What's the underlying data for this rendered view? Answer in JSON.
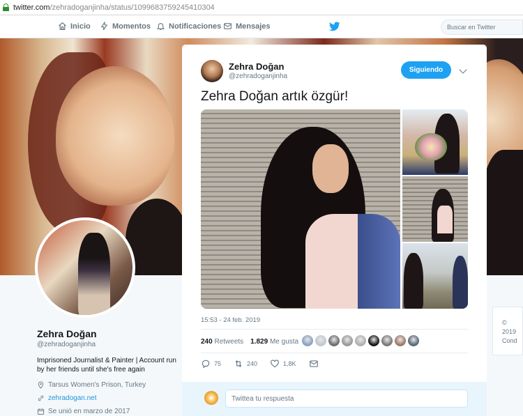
{
  "browser": {
    "url_host": "twitter.com",
    "url_path": "/zehradoganjinha/status/1099683759245410304"
  },
  "nav": {
    "items": [
      {
        "label": "Inicio",
        "icon": "home-icon"
      },
      {
        "label": "Momentos",
        "icon": "bolt-icon"
      },
      {
        "label": "Notificaciones",
        "icon": "bell-icon"
      },
      {
        "label": "Mensajes",
        "icon": "envelope-icon"
      }
    ],
    "search_placeholder": "Buscar en Twitter"
  },
  "profile": {
    "name": "Zehra Doğan",
    "handle": "@zehradoganjinha",
    "bio": "Imprisoned Journalist & Painter | Account run by her friends until she's free again",
    "location": "Tarsus Women's Prison, Turkey",
    "website": "zehradogan.net",
    "joined": "Se unió en marzo de 2017"
  },
  "side_card": {
    "line1": "© 2019",
    "line2": "Cond"
  },
  "tweet": {
    "author_name": "Zehra Doğan",
    "author_handle": "@zehradoganjinha",
    "follow_label": "Siguiendo",
    "text": "Zehra Doğan artık özgür!",
    "timestamp": "15:53 - 24 feb. 2019",
    "retweets_count": "240",
    "retweets_label": "Retweets",
    "likes_count": "1.829",
    "likes_label": "Me gusta",
    "liker_colors": [
      "#8aa4c0",
      "#c0c8d0",
      "#6e6e6e",
      "#9a9a9a",
      "#b0b0b0",
      "#1a1a1a",
      "#7a7a7a",
      "#a07a6a",
      "#5a6a7a"
    ],
    "actions": {
      "reply_count": "75",
      "retweet_count": "240",
      "like_count": "1,8K"
    },
    "reply_placeholder": "Twittea tu respuesta"
  },
  "colors": {
    "accent": "#1da1f2",
    "text_secondary": "#657786"
  }
}
